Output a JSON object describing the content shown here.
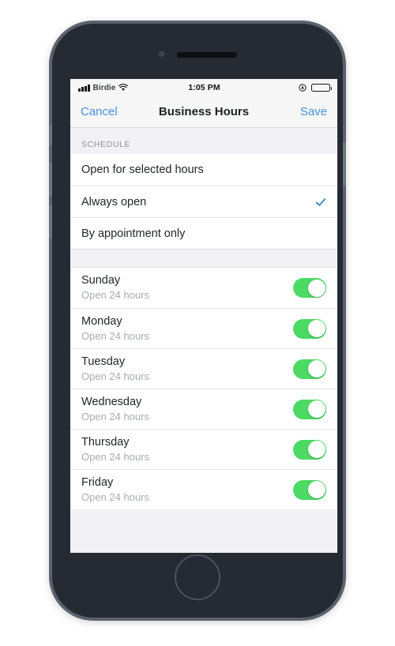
{
  "status_bar": {
    "signal_icon": "signal-bars-icon",
    "carrier": "Birdie",
    "wifi_icon": "wifi-icon",
    "time": "1:05 PM",
    "location_icon": "location-arrow-icon",
    "battery_icon": "battery-full-icon"
  },
  "nav_bar": {
    "cancel_label": "Cancel",
    "title": "Business Hours",
    "save_label": "Save",
    "link_color": "#4a90d9"
  },
  "schedule_section": {
    "header": "SCHEDULE",
    "options": [
      {
        "label": "Open for selected hours",
        "selected": false
      },
      {
        "label": "Always open",
        "selected": true
      },
      {
        "label": "By appointment only",
        "selected": false
      }
    ],
    "check_icon": "check-icon",
    "check_color": "#3d86c6"
  },
  "days_section": {
    "toggle_on_color": "#4cd964",
    "days": [
      {
        "name": "Sunday",
        "hours": "Open 24 hours",
        "enabled": true
      },
      {
        "name": "Monday",
        "hours": "Open 24 hours",
        "enabled": true
      },
      {
        "name": "Tuesday",
        "hours": "Open 24 hours",
        "enabled": true
      },
      {
        "name": "Wednesday",
        "hours": "Open 24 hours",
        "enabled": true
      },
      {
        "name": "Thursday",
        "hours": "Open 24 hours",
        "enabled": true
      },
      {
        "name": "Friday",
        "hours": "Open 24 hours",
        "enabled": true
      }
    ]
  }
}
